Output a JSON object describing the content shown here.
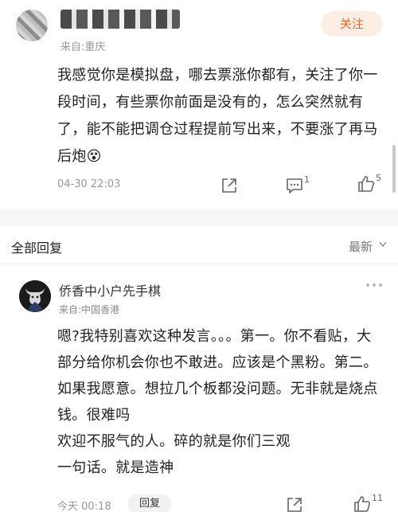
{
  "post": {
    "origin": "来自:重庆",
    "follow_label": "关注",
    "text": "我感觉你是模拟盘，哪去票涨你都有，关注了你一段时间，有些票你前面是没有的，怎么突然就有了，能不能把调仓过程提前写出来，不要涨了再马后炮😵",
    "time": "04-30 22:03",
    "comment_count": "1",
    "like_count": "5"
  },
  "replies_header": {
    "title": "全部回复",
    "sort_label": "最新"
  },
  "reply": {
    "username": "侨香中小户先手棋",
    "origin": "来自:中国香港",
    "lines": [
      "嗯?我特别喜欢这种发言。。。第一。你不看贴，大部分给你机会你也不敢进。应该是个黑粉。第二。如果我愿意。想拉几个板都没问题。无非就是烧点钱。很难吗",
      "欢迎不服气的人。碎的就是你们三观",
      "一句话。就是造神"
    ],
    "time": "今天 00:18",
    "reply_label": "回复",
    "like_count": "11"
  },
  "icons": {
    "share": "share-icon",
    "comment": "comment-icon",
    "like": "thumbs-up-icon",
    "more": "more-dots-icon",
    "chevron": "chevron-down-icon"
  },
  "colors": {
    "accent": "#f0652a",
    "follow_bg": "#fdeee5",
    "muted": "#999999",
    "divider_bg": "#f6f6f6"
  }
}
